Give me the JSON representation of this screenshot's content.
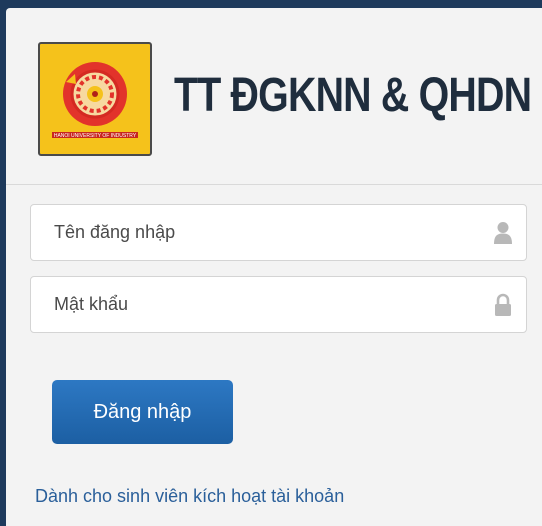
{
  "brand": {
    "title": "TT ĐGKNN & QHDN",
    "logo_icon": "university-logo-icon",
    "logo_text": "HANOI UNIVERSITY OF INDUSTRY"
  },
  "form": {
    "username": {
      "placeholder": "Tên đăng nhập",
      "value": "",
      "icon": "user-icon"
    },
    "password": {
      "placeholder": "Mật khẩu",
      "value": "",
      "icon": "lock-icon"
    },
    "submit_label": "Đăng nhập"
  },
  "links": {
    "activate_label": "Dành cho sinh viên kích hoạt tài khoản"
  },
  "colors": {
    "background": "#1e3a5c",
    "panel": "#f3f3f3",
    "button": "#1f66ad",
    "link": "#2a5f9a",
    "logo": "#f5c21b"
  }
}
